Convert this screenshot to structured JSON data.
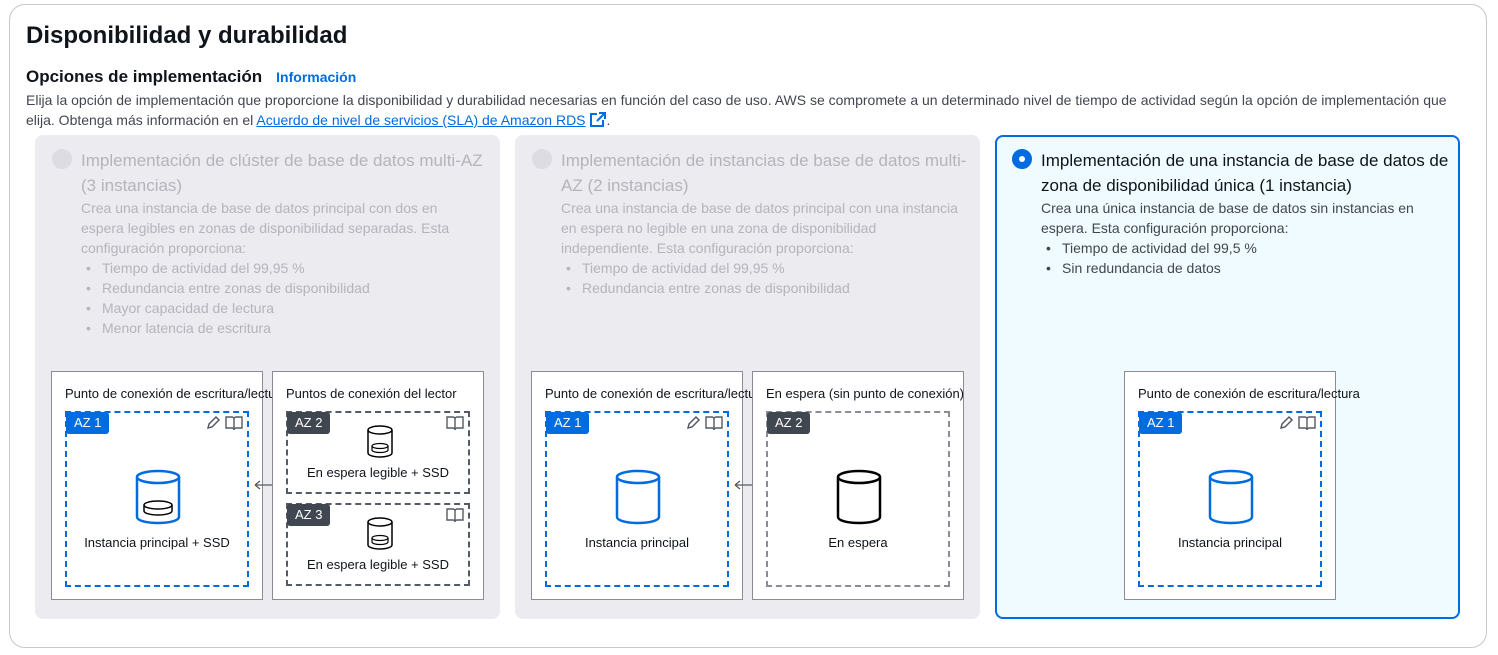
{
  "page": {
    "title": "Disponibilidad y durabilidad",
    "section_title": "Opciones de implementación",
    "info_link": "Información",
    "description": "Elija la opción de implementación que proporcione la disponibilidad y durabilidad necesarias en función del caso de uso. AWS se compromete a un determinado nivel de tiempo de actividad según la opción de implementación que elija. Obtenga más información en el",
    "sla_link": "Acuerdo de nivel de servicios (SLA) de Amazon RDS",
    "description_end": "."
  },
  "colors": {
    "accent": "#006ce0",
    "disabled_bg": "#ebebf0",
    "selected_bg": "#f0fbff"
  },
  "options": [
    {
      "title": "Implementación de clúster de base de datos multi-AZ (3 instancias)",
      "selected": false,
      "disabled": true,
      "description": "Crea una instancia de base de datos principal con dos en espera legibles en zonas de disponibilidad separadas. Esta configuración proporciona:",
      "bullets": [
        "Tiempo de actividad del 99,95 %",
        "Redundancia entre zonas de disponibilidad",
        "Mayor capacidad de lectura",
        "Menor latencia de escritura"
      ],
      "diagram": {
        "writer_endpoint": "Punto de conexión de escritura/lectura",
        "reader_endpoint": "Puntos de conexión del lector",
        "az1": "AZ 1",
        "az2": "AZ 2",
        "az3": "AZ 3",
        "primary": "Instancia principal + SSD",
        "standby2": "En espera legible + SSD",
        "standby3": "En espera legible + SSD"
      }
    },
    {
      "title": "Implementación de instancias de base de datos multi-AZ (2 instancias)",
      "selected": false,
      "disabled": true,
      "description": "Crea una instancia de base de datos principal con una instancia en espera no legible en una zona de disponibilidad independiente. Esta configuración proporciona:",
      "bullets": [
        "Tiempo de actividad del 99,95 %",
        "Redundancia entre zonas de disponibilidad"
      ],
      "diagram": {
        "writer_endpoint": "Punto de conexión de escritura/lectura",
        "standby_endpoint": "En espera (sin punto de conexión)",
        "az1": "AZ 1",
        "az2": "AZ 2",
        "primary": "Instancia principal",
        "standby": "En espera"
      }
    },
    {
      "title": "Implementación de una instancia de base de datos de zona de disponibilidad única (1 instancia)",
      "selected": true,
      "disabled": false,
      "description": "Crea una única instancia de base de datos sin instancias en espera. Esta configuración proporciona:",
      "bullets": [
        "Tiempo de actividad del 99,5 %",
        "Sin redundancia de datos"
      ],
      "diagram": {
        "writer_endpoint": "Punto de conexión de escritura/lectura",
        "az1": "AZ 1",
        "primary": "Instancia principal"
      }
    }
  ]
}
